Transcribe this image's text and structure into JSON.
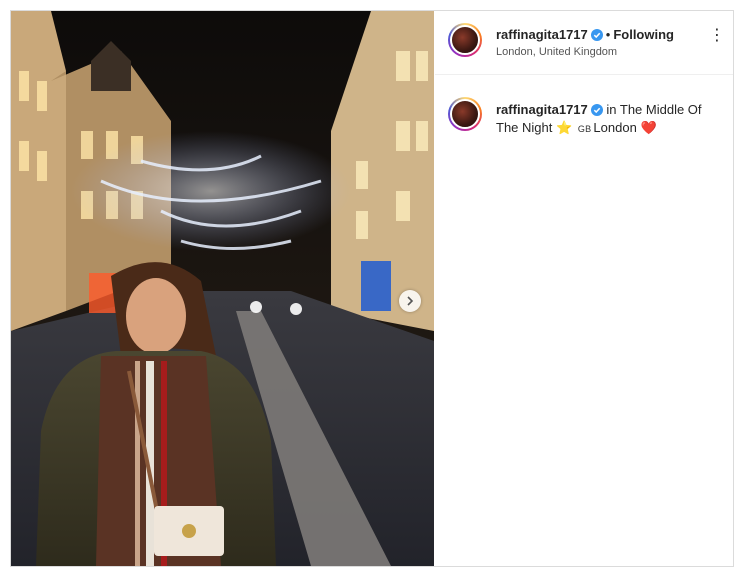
{
  "post": {
    "username": "raffinagita1717",
    "follow_status": "Following",
    "separator": "•",
    "location": "London, United Kingdom",
    "more_icon": "⋮",
    "caption": {
      "username": "raffinagita1717",
      "text_part1": "in The Middle Of The Night",
      "star": "⭐",
      "flag_code": "GB",
      "text_part2": "London",
      "heart": "❤️"
    },
    "next_icon": "chevron-right-icon"
  },
  "colors": {
    "verified": "#3897f0",
    "heart": "#ed1c24",
    "star": "#f5c518"
  }
}
